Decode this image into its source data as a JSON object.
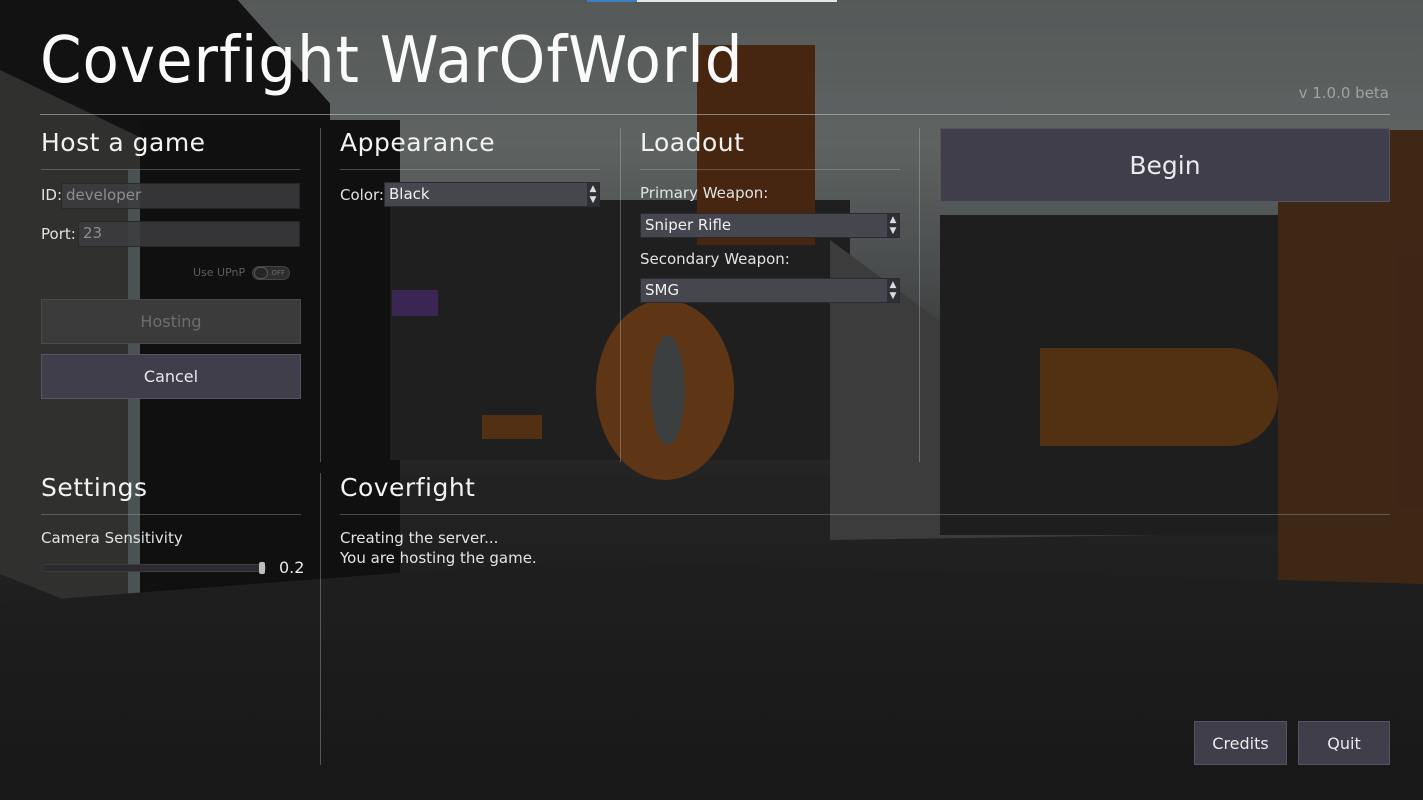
{
  "app": {
    "title": "Coverfight WarOfWorld",
    "version": "v 1.0.0 beta",
    "loading_progress": 0.2
  },
  "host": {
    "heading": "Host a game",
    "id_label": "ID:",
    "id_value": "developer",
    "port_label": "Port:",
    "port_value": "23",
    "upnp_label": "Use UPnP",
    "upnp_state": "OFF",
    "hosting_button": "Hosting",
    "cancel_button": "Cancel"
  },
  "appearance": {
    "heading": "Appearance",
    "color_label": "Color:",
    "color_value": "Black"
  },
  "loadout": {
    "heading": "Loadout",
    "primary_label": "Primary Weapon:",
    "primary_value": "Sniper Rifle",
    "secondary_label": "Secondary Weapon:",
    "secondary_value": "SMG"
  },
  "begin_button": "Begin",
  "settings": {
    "heading": "Settings",
    "camera_label": "Camera Sensitivity",
    "camera_value": "0.2",
    "camera_slider_fraction": 1.0
  },
  "status": {
    "heading": "Coverfight",
    "lines": [
      "Creating the server...",
      "You are hosting the game."
    ]
  },
  "footer": {
    "credits_button": "Credits",
    "quit_button": "Quit"
  },
  "icons": {
    "select_arrows": "↕"
  }
}
